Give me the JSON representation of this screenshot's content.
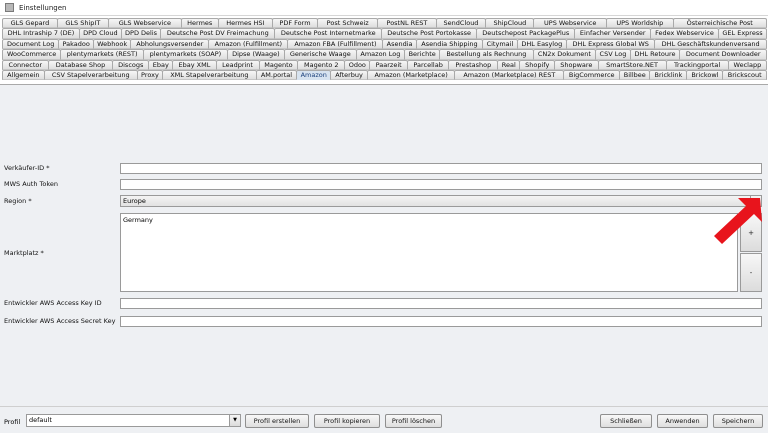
{
  "window": {
    "title": "Einstellungen"
  },
  "tab_rows": [
    [
      "GLS Gepard",
      "GLS ShipIT",
      "GLS Webservice",
      "Hermes",
      "Hermes HSI",
      "PDF Form",
      "Post Schweiz",
      "PostNL REST",
      "SendCloud",
      "ShipCloud",
      "UPS Webservice",
      "UPS Worldship",
      "Österreichische Post"
    ],
    [
      "DHL Intraship 7 (DE)",
      "DPD Cloud",
      "DPD Delis",
      "Deutsche Post DV Freimachung",
      "Deutsche Post Internetmarke",
      "Deutsche Post Portokasse",
      "Deutschepost PackagePlus",
      "Einfacher Versender",
      "Fedex Webservice",
      "GEL Express"
    ],
    [
      "Document Log",
      "Pakadoo",
      "Webhook",
      "Abholungsversender",
      "Amazon (Fulfillment)",
      "Amazon FBA (Fulfillment)",
      "Asendia",
      "Asendia Shipping",
      "Citymail",
      "DHL Easylog",
      "DHL Express Global WS",
      "DHL Geschäftskundenversand"
    ],
    [
      "WooCommerce",
      "plentymarkets (REST)",
      "plentymarkets (SOAP)",
      "Dipse (Waage)",
      "Generische Waage",
      "Amazon Log",
      "Berichte",
      "Bestellung als Rechnung",
      "CN2x Dokument",
      "CSV Log",
      "DHL Retoure",
      "Document Downloader"
    ],
    [
      "Connector",
      "Database Shop",
      "Discogs",
      "Ebay",
      "Ebay XML",
      "Leadprint",
      "Magento",
      "Magento 2",
      "Odoo",
      "Paarzeit",
      "Parcellab",
      "Prestashop",
      "Real",
      "Shopify",
      "Shopware",
      "SmartStore.NET",
      "Trackingportal",
      "Weclapp"
    ],
    [
      "Allgemein",
      "CSV Stapelverarbeitung",
      "Proxy",
      "XML Stapelverarbeitung",
      "AM.portal",
      "Amazon",
      "Afterbuy",
      "Amazon (Marketplace)",
      "Amazon (Marketplace) REST",
      "BigCommerce",
      "Billbee",
      "Bricklink",
      "Brickowl",
      "Brickscout"
    ]
  ],
  "active_tab": "Amazon",
  "form": {
    "verkaeufer_label": "Verkäufer-ID *",
    "verkaeufer_value": "",
    "mws_label": "MWS Auth Token",
    "mws_value": "",
    "region_label": "Region *",
    "region_value": "Europe",
    "marktplatz_label": "Marktplatz *",
    "marktplatz_items": [
      "Germany"
    ],
    "add_label": "+",
    "remove_label": "-",
    "access_key_label": "Entwickler AWS Access Key ID",
    "access_key_value": "",
    "secret_key_label": "Entwickler AWS Access Secret Key",
    "secret_key_value": ""
  },
  "bottom": {
    "profil_label": "Profil",
    "profil_value": "default",
    "erstellen_label": "Profil erstellen",
    "kopieren_label": "Profil kopieren",
    "loeschen_label": "Profil löschen",
    "schliessen_label": "Schließen",
    "anwenden_label": "Anwenden",
    "speichern_label": "Speichern"
  },
  "colors": {
    "annotation_arrow": "#e8141c",
    "active_tab": "#d7e3f0"
  },
  "icons": {
    "select_arrow": "chevron-down-icon"
  }
}
